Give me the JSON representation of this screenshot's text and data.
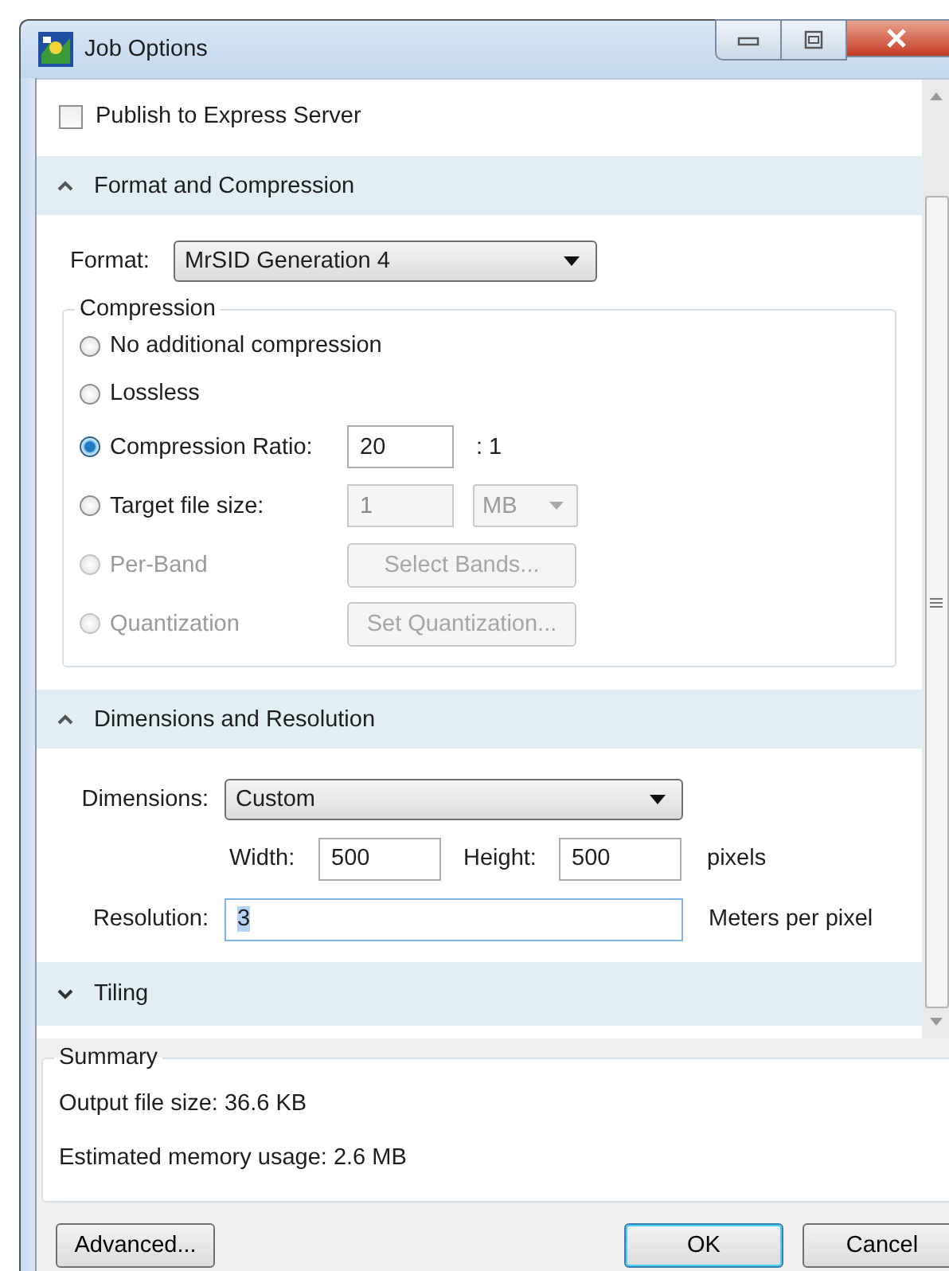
{
  "window": {
    "title": "Job Options"
  },
  "publish": {
    "label": "Publish to Express Server",
    "checked": false
  },
  "format_section": {
    "title": "Format and Compression",
    "expanded": true,
    "format_label": "Format:",
    "format_value": "MrSID Generation 4",
    "compression": {
      "title": "Compression",
      "options": [
        {
          "kind": "plain",
          "label": "No additional compression",
          "selected": false,
          "disabled": false
        },
        {
          "kind": "plain",
          "label": "Lossless",
          "selected": false,
          "disabled": false
        },
        {
          "kind": "ratio",
          "label": "Compression Ratio:",
          "selected": true,
          "disabled": false,
          "value": "20",
          "control_disabled": false,
          "suffix": ": 1"
        },
        {
          "kind": "size",
          "label": "Target file size:",
          "selected": false,
          "disabled": false,
          "value": "1",
          "unit": "MB",
          "control_disabled": true
        },
        {
          "kind": "button",
          "label": "Per-Band",
          "selected": false,
          "disabled": true,
          "button": "Select Bands...",
          "control_disabled": true
        },
        {
          "kind": "button",
          "label": "Quantization",
          "selected": false,
          "disabled": true,
          "button": "Set Quantization...",
          "control_disabled": true
        }
      ]
    }
  },
  "dimensions_section": {
    "title": "Dimensions and Resolution",
    "expanded": true,
    "dimensions_label": "Dimensions:",
    "dimensions_value": "Custom",
    "width_label": "Width:",
    "width_value": "500",
    "height_label": "Height:",
    "height_value": "500",
    "size_unit": "pixels",
    "resolution_label": "Resolution:",
    "resolution_value": "3",
    "resolution_value_selected": true,
    "resolution_unit": "Meters per pixel"
  },
  "tiling_section": {
    "title": "Tiling",
    "expanded": false
  },
  "summary": {
    "title": "Summary",
    "lines": [
      "Output file size: 36.6 KB",
      "Estimated memory usage: 2.6 MB"
    ]
  },
  "buttons": [
    {
      "label": "Advanced...",
      "default": false
    },
    {
      "label": "OK",
      "default": true
    },
    {
      "label": "Cancel",
      "default": false
    }
  ]
}
